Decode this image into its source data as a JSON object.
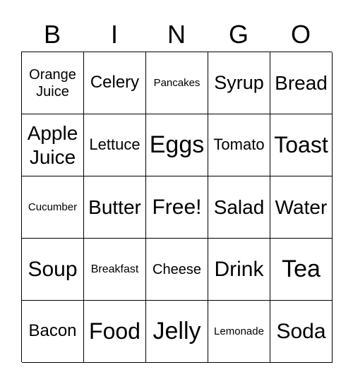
{
  "header": [
    "B",
    "I",
    "N",
    "G",
    "O"
  ],
  "cells": [
    [
      "Orange Juice",
      "Celery",
      "Pancakes",
      "Syrup",
      "Bread"
    ],
    [
      "Apple Juice",
      "Lettuce",
      "Eggs",
      "Tomato",
      "Toast"
    ],
    [
      "Cucumber",
      "Butter",
      "Free!",
      "Salad",
      "Water"
    ],
    [
      "Soup",
      "Breakfast",
      "Cheese",
      "Drink",
      "Tea"
    ],
    [
      "Bacon",
      "Food",
      "Jelly",
      "Lemonade",
      "Soda"
    ]
  ]
}
